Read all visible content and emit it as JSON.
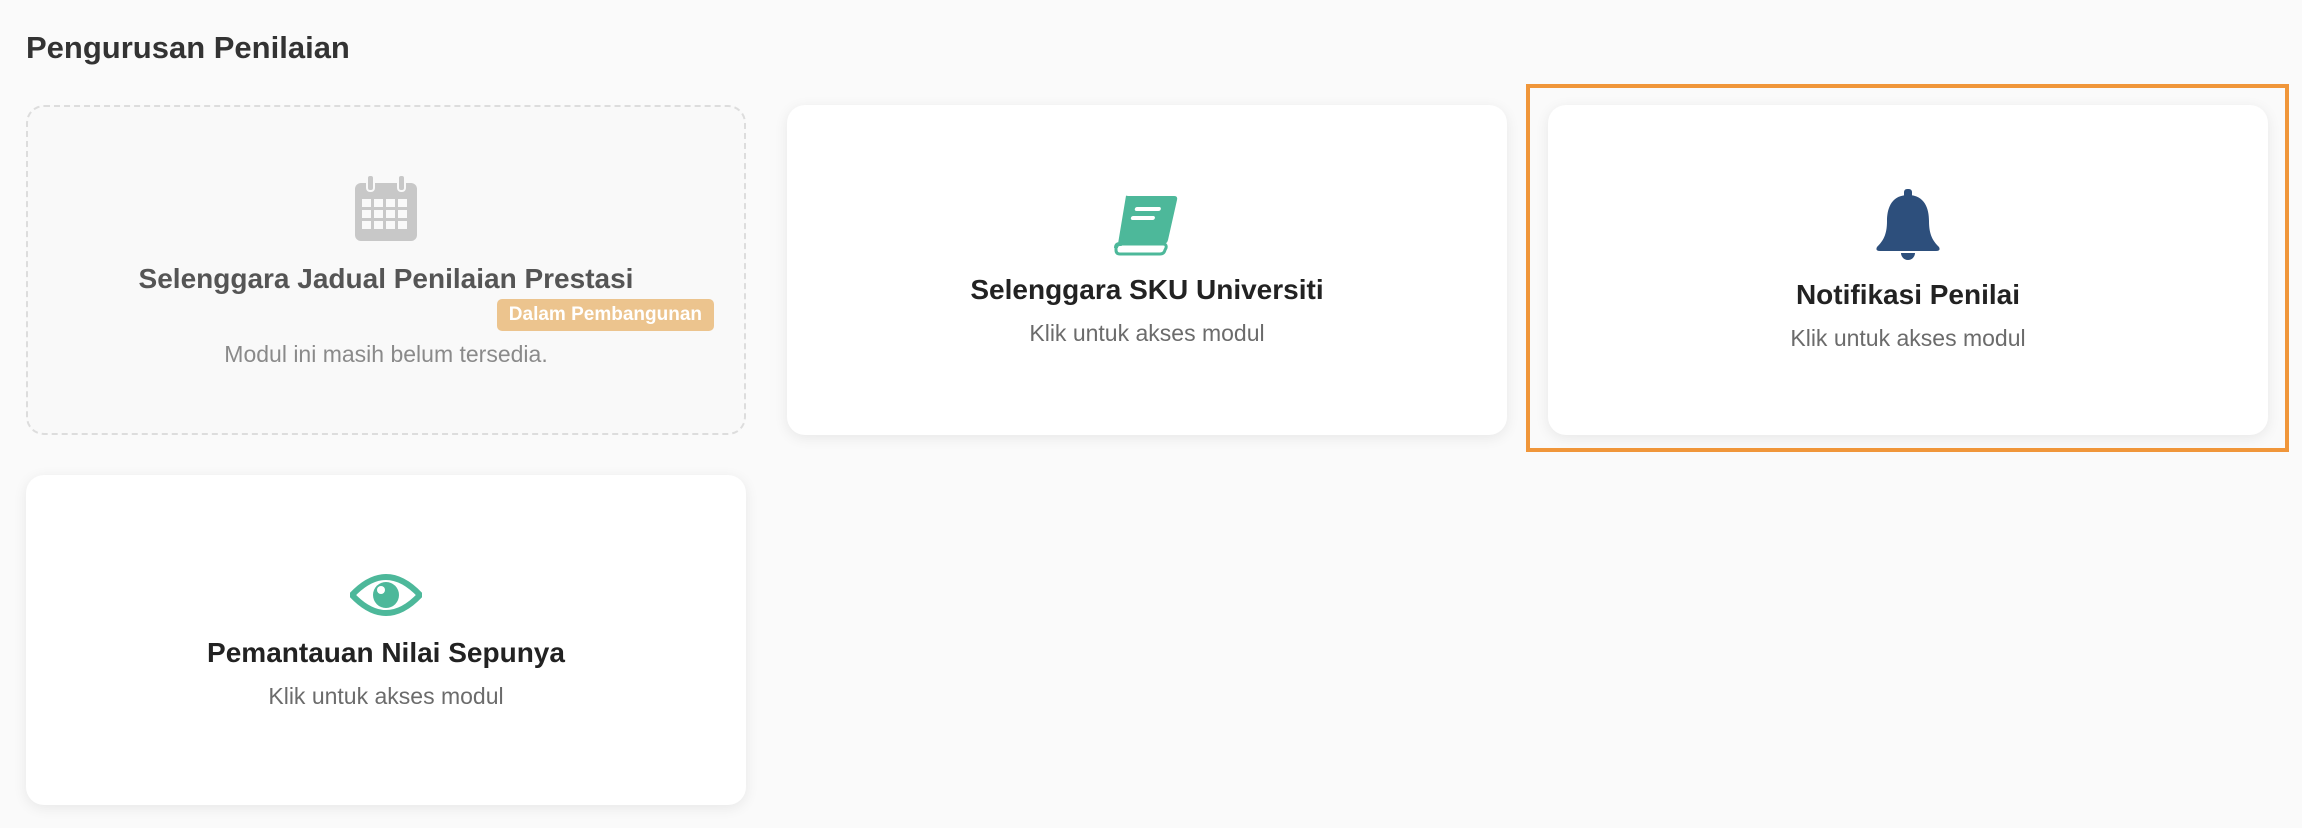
{
  "section": {
    "title": "Pengurusan Penilaian"
  },
  "cards": [
    {
      "title": "Selenggara Jadual Penilaian Prestasi",
      "badge": "Dalam Pembangunan",
      "subtitle": "Modul ini masih belum tersedia.",
      "icon": "calendar-icon",
      "icon_color": "#c8c8c8",
      "status": "disabled"
    },
    {
      "title": "Selenggara SKU Universiti",
      "subtitle": "Klik untuk akses modul",
      "icon": "book-icon",
      "icon_color": "#4db89a"
    },
    {
      "title": "Notifikasi Penilai",
      "subtitle": "Klik untuk akses modul",
      "icon": "bell-icon",
      "icon_color": "#2d4f7c",
      "selected": true
    },
    {
      "title": "Pemantauan Nilai Sepunya",
      "subtitle": "Klik untuk akses modul",
      "icon": "eye-icon",
      "icon_color": "#4db89a"
    }
  ],
  "colors": {
    "highlight": "#f0963a",
    "badge": "#ecc48e"
  }
}
